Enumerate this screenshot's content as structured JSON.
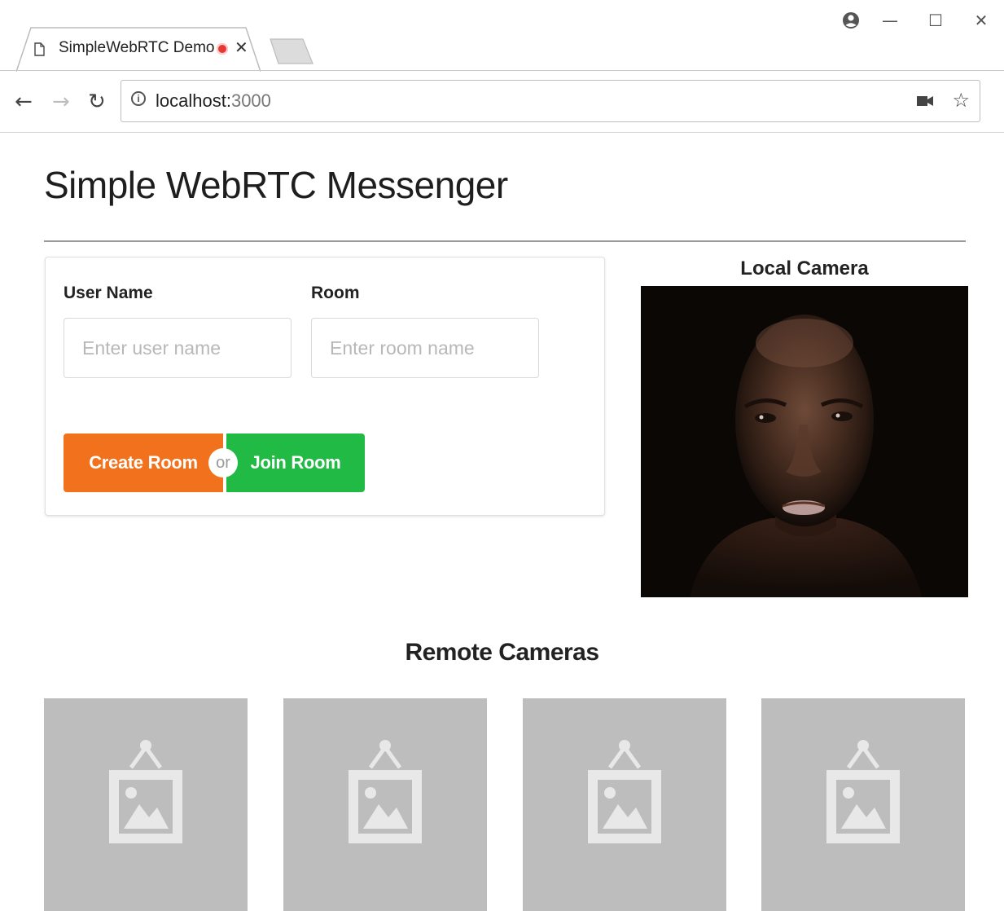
{
  "browser": {
    "tab_title": "SimpleWebRTC Demo",
    "url_host": "localhost:",
    "url_port": "3000"
  },
  "page": {
    "title": "Simple WebRTC Messenger"
  },
  "form": {
    "user_label": "User Name",
    "user_placeholder": "Enter user name",
    "room_label": "Room",
    "room_placeholder": "Enter room name",
    "create_label": "Create Room",
    "or_label": "or",
    "join_label": "Join Room"
  },
  "local": {
    "label": "Local Camera"
  },
  "remote": {
    "heading": "Remote Cameras",
    "tiles": [
      {
        "icon": "image-placeholder-icon"
      },
      {
        "icon": "image-placeholder-icon"
      },
      {
        "icon": "image-placeholder-icon"
      },
      {
        "icon": "image-placeholder-icon"
      }
    ]
  },
  "colors": {
    "create_button": "#f2711c",
    "join_button": "#21ba45",
    "placeholder_tile": "#bdbdbd"
  }
}
